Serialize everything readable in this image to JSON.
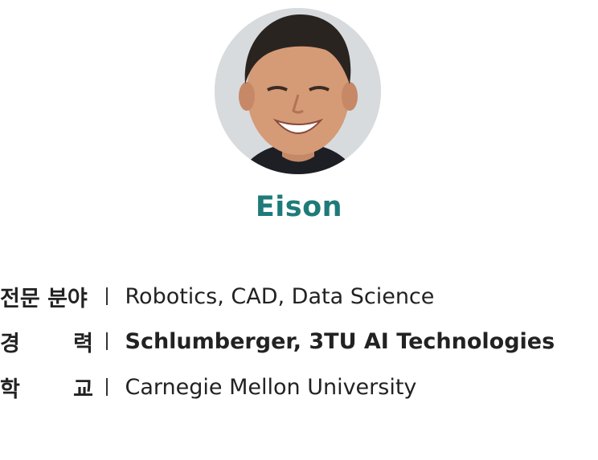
{
  "profile": {
    "name": "Eison",
    "avatar_icon": "person-photo"
  },
  "info": {
    "field": {
      "label": "전문 분야",
      "value": "Robotics, CAD, Data Science"
    },
    "career": {
      "label_left": "경",
      "label_right": "력",
      "value": "Schlumberger, 3TU AI Technologies"
    },
    "school": {
      "label_left": "학",
      "label_right": "교",
      "value": "Carnegie Mellon University"
    }
  },
  "colors": {
    "name": "#1f7a7a",
    "text": "#222222"
  }
}
